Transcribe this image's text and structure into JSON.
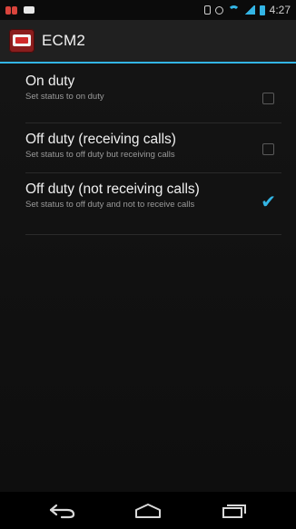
{
  "status": {
    "time": "4:27"
  },
  "app": {
    "title": "ECM2"
  },
  "preferences": [
    {
      "title": "On duty",
      "summary": "Set status to on duty",
      "checked": false
    },
    {
      "title": "Off duty (receiving calls)",
      "summary": "Set status to off duty but receiving calls",
      "checked": false
    },
    {
      "title": "Off duty (not receiving calls)",
      "summary": "Set status to off duty and not to receive calls",
      "checked": true
    }
  ],
  "colors": {
    "accent": "#33b5e5",
    "background": "#111111",
    "actionbar": "#202020"
  },
  "icons": {
    "back": "back-icon",
    "home": "home-icon",
    "recents": "recents-icon"
  }
}
